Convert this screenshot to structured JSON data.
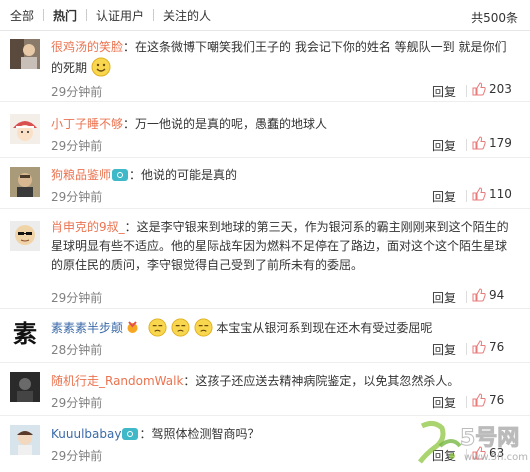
{
  "tabs": [
    {
      "label": "全部"
    },
    {
      "label": "热门"
    },
    {
      "label": "认证用户"
    },
    {
      "label": "关注的人"
    }
  ],
  "total_label": "共500条",
  "reply_label": "回复",
  "comments": [
    {
      "user": "很鸡汤的笑脸",
      "text": "：在这条微博下嘲笑我们王子的 我会记下你的姓名 等舰队一到 就是你们的死期",
      "time": "29分钟前",
      "likes": "203"
    },
    {
      "user": "小丁子睡不够",
      "text": "：万一他说的是真的呢，愚蠢的地球人",
      "time": "29分钟前",
      "likes": "179"
    },
    {
      "user": "狗粮品鉴师",
      "text": "：他说的可能是真的",
      "time": "29分钟前",
      "likes": "110"
    },
    {
      "user": "肖申克的9叔_",
      "text": "：这是李守银来到地球的第三天，作为银河系的霸主刚刚来到这个陌生的星球明显有些不适应。他的星际战车因为燃料不足停在了路边，面对这个这个陌生星球的原住民的质问，李守银觉得自己受到了前所未有的委屈。",
      "time": "29分钟前",
      "likes": "94"
    },
    {
      "user": "素素素半步颠",
      "text": "本宝宝从银河系到现在还木有受过委屈呢",
      "time": "28分钟前",
      "likes": "76"
    },
    {
      "user": "随机行走_RandomWalk",
      "text": "：这孩子还应送去精神病院鉴定，以免其忽然杀人。",
      "time": "29分钟前",
      "likes": "76"
    },
    {
      "user": "Kuuulbabay",
      "text": "：驾照体检测智商吗？",
      "time": "29分钟前",
      "likes": "63"
    }
  ],
  "avatar_glyphs": {
    "c5": "素"
  },
  "watermark": {
    "brand": "5号网",
    "url": "www.5h.com"
  },
  "colors": {
    "username": "#eb7350",
    "username_blue": "#3b6aa8",
    "time": "#808080",
    "like_icon": "#f5a0a0"
  }
}
